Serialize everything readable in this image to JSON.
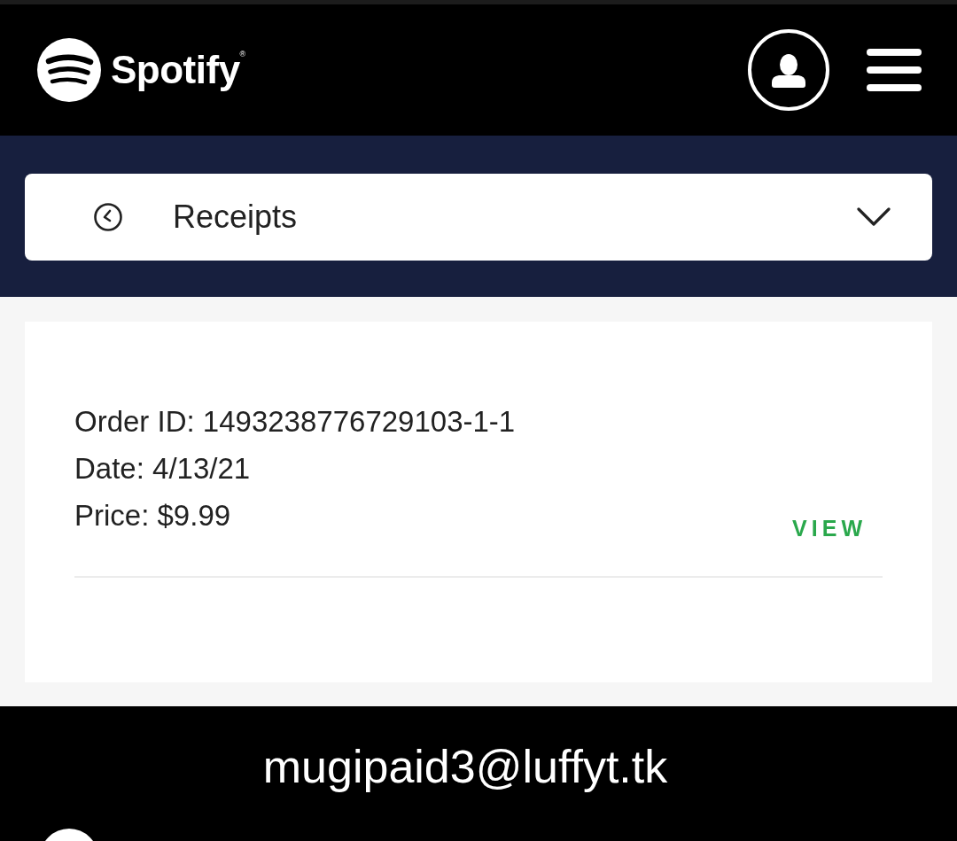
{
  "header": {
    "logo_text": "Spotify$^{®}$"
  },
  "section_selector": {
    "label": "Receipts",
    "expanded": false
  },
  "receipts": [
    {
      "order_id": "Order ID: 1493238776729103-1-1",
      "date": "Date: 4/13/21",
      "price": "Price: $9.99",
      "action": "VIEW"
    }
  ],
  "footer": {
    "email": "mugipaid3@luffyt.tk"
  }
}
